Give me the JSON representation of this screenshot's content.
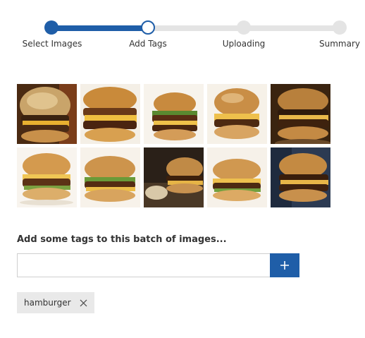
{
  "stepper": {
    "steps": [
      {
        "label": "Select Images",
        "state": "done"
      },
      {
        "label": "Add Tags",
        "state": "current"
      },
      {
        "label": "Uploading",
        "state": "todo"
      },
      {
        "label": "Summary",
        "state": "todo"
      }
    ]
  },
  "colors": {
    "accent": "#1f5ea8",
    "inactive": "#e4e4e4",
    "chip": "#e9e9e9"
  },
  "images": {
    "count": 10,
    "items": [
      {
        "subject": "hamburger",
        "background": "dark"
      },
      {
        "subject": "hamburger",
        "background": "light"
      },
      {
        "subject": "hamburger",
        "background": "light"
      },
      {
        "subject": "hamburger",
        "background": "light"
      },
      {
        "subject": "hamburger",
        "background": "dark"
      },
      {
        "subject": "hamburger",
        "background": "light"
      },
      {
        "subject": "hamburger",
        "background": "light"
      },
      {
        "subject": "hamburger",
        "background": "dark"
      },
      {
        "subject": "hamburger",
        "background": "light"
      },
      {
        "subject": "hamburger",
        "background": "dark-blue"
      }
    ]
  },
  "tag_form": {
    "prompt": "Add some tags to this batch of images...",
    "input_value": "",
    "input_placeholder": "",
    "add_icon": "plus-icon"
  },
  "tags": [
    {
      "label": "hamburger",
      "remove_icon": "close-icon"
    }
  ]
}
